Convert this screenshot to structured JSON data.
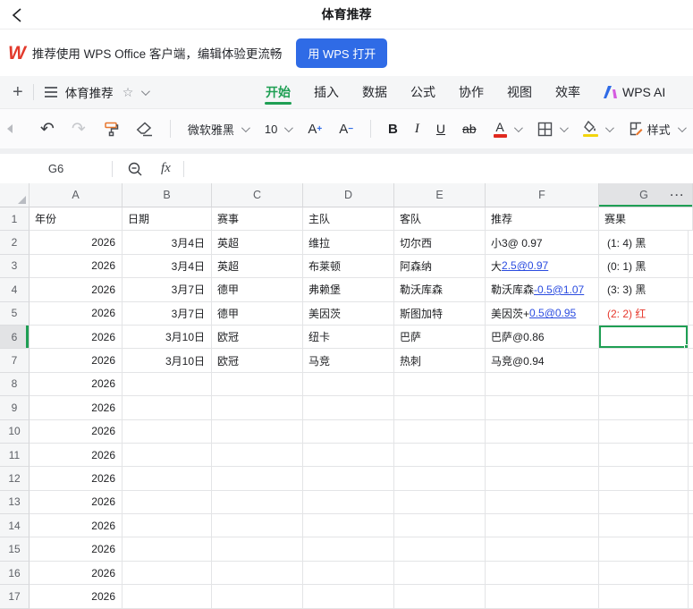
{
  "top_bar": {
    "title": "体育推荐"
  },
  "banner": {
    "logo_text": "W",
    "message": "推荐使用 WPS Office 客户端，编辑体验更流畅",
    "open_button": "用 WPS 打开"
  },
  "menu_bar": {
    "plus": "+",
    "doc_title": "体育推荐",
    "star_icon": "☆",
    "tabs": [
      {
        "label": "开始",
        "active": true
      },
      {
        "label": "插入",
        "active": false
      },
      {
        "label": "数据",
        "active": false
      },
      {
        "label": "公式",
        "active": false
      },
      {
        "label": "协作",
        "active": false
      },
      {
        "label": "视图",
        "active": false
      },
      {
        "label": "效率",
        "active": false
      },
      {
        "label": "WPS AI",
        "active": false,
        "has_logo": true
      }
    ]
  },
  "toolbar": {
    "undo": "↶",
    "redo": "↷",
    "font_name": "微软雅黑",
    "font_size": "10",
    "grow_font": "A",
    "grow_plus": "+",
    "shrink_font": "A",
    "shrink_minus": "−",
    "bold": "B",
    "italic": "I",
    "underline": "U",
    "strikethrough": "ab",
    "font_color_letter": "A",
    "style_label": "样式"
  },
  "formula_bar": {
    "cell_ref": "G6",
    "fx_label": "fx"
  },
  "grid": {
    "selected_cell": "G6",
    "more_cols": "···",
    "columns": [
      "A",
      "B",
      "C",
      "D",
      "E",
      "F",
      "G"
    ],
    "header_row": [
      "年份",
      "日期",
      "赛事",
      "主队",
      "客队",
      "推荐",
      "赛果"
    ],
    "rows": [
      {
        "n": 2,
        "a": "2026",
        "b": "3月4日",
        "c": "英超",
        "d": "维拉",
        "e": "切尔西",
        "f": [
          {
            "t": "小3@ 0.97"
          }
        ],
        "g": "(1: 4) 黑",
        "g_red": false
      },
      {
        "n": 3,
        "a": "2026",
        "b": "3月4日",
        "c": "英超",
        "d": "布莱顿",
        "e": "阿森纳",
        "f": [
          {
            "t": "大"
          },
          {
            "t": "2.5@0.97",
            "link": true
          }
        ],
        "g": "(0: 1) 黑",
        "g_red": false
      },
      {
        "n": 4,
        "a": "2026",
        "b": "3月7日",
        "c": "德甲",
        "d": "弗赖堡",
        "e": "勒沃库森",
        "f": [
          {
            "t": "勒沃库森"
          },
          {
            "t": "-0.5@1.07",
            "link": true
          }
        ],
        "g": "(3: 3) 黑",
        "g_red": false
      },
      {
        "n": 5,
        "a": "2026",
        "b": "3月7日",
        "c": "德甲",
        "d": "美因茨",
        "e": "斯图加特",
        "f": [
          {
            "t": "美因茨+"
          },
          {
            "t": "0.5@0.95",
            "link": true
          }
        ],
        "g": "(2: 2) 红",
        "g_red": true
      },
      {
        "n": 6,
        "a": "2026",
        "b": "3月10日",
        "c": "欧冠",
        "d": "纽卡",
        "e": "巴萨",
        "f": [
          {
            "t": "巴萨@0.86"
          }
        ],
        "g": "",
        "selected": true
      },
      {
        "n": 7,
        "a": "2026",
        "b": "3月10日",
        "c": "欧冠",
        "d": "马竞",
        "e": "热刺",
        "f": [
          {
            "t": "马竞@0.94"
          }
        ],
        "g": ""
      },
      {
        "n": 8,
        "a": "2026"
      },
      {
        "n": 9,
        "a": "2026"
      },
      {
        "n": 10,
        "a": "2026"
      },
      {
        "n": 11,
        "a": "2026"
      },
      {
        "n": 12,
        "a": "2026"
      },
      {
        "n": 13,
        "a": "2026"
      },
      {
        "n": 14,
        "a": "2026"
      },
      {
        "n": 15,
        "a": "2026"
      },
      {
        "n": 16,
        "a": "2026"
      },
      {
        "n": 17,
        "a": "2026"
      }
    ]
  },
  "colors": {
    "accent_green": "#1f9f54",
    "link_blue": "#2b4ce0",
    "result_red": "#e6372b",
    "button_blue": "#2f6be6",
    "logo_red": "#e23a2c",
    "font_color_bar": "#e0281e",
    "fill_color_bar": "#f2d40c"
  }
}
